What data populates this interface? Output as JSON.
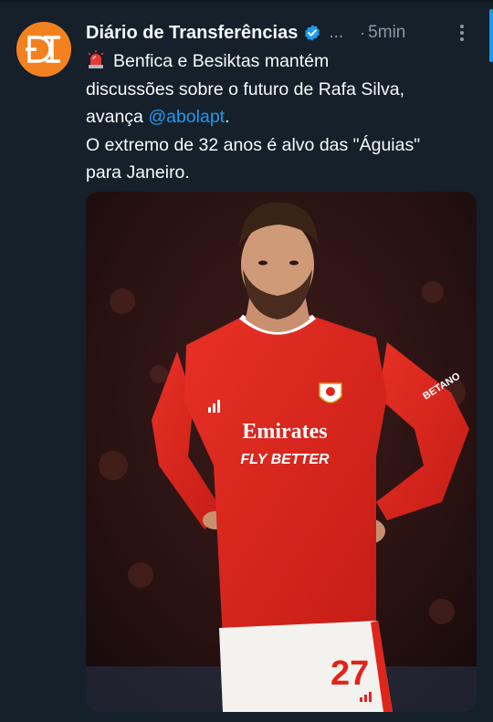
{
  "author": {
    "name": "Diário de Transferências",
    "handle_truncated": "...",
    "time_separator": "·",
    "time": "5min",
    "avatar_icon": "dt-logo-icon",
    "avatar_color": "#f4811f",
    "verified_color": "#1d9bf0"
  },
  "tweet": {
    "line1": "Benfica e Besiktas mantém",
    "line2": "discussões sobre o futuro de Rafa Silva,",
    "line3_prefix": "avança",
    "mention": "@abolapt",
    "line3_suffix": ".",
    "line4": "O extremo de 32 anos é alvo das \"Águias\"",
    "line5": "para Janeiro.",
    "emoji_icon": "siren-icon"
  },
  "media": {
    "jersey_sponsor_1": "Emirates",
    "jersey_sponsor_2": "FLY BETTER",
    "jersey_number": "27",
    "sleeve_sponsor": "BETANO",
    "jersey_color": "#e0251b"
  }
}
